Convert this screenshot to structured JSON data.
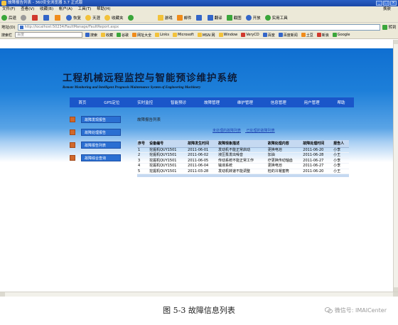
{
  "browser": {
    "title": "故障报告列表 - 360安全浏览器 3.7 正式版",
    "menu": [
      "文件(F)",
      "查看(V)",
      "收藏(B)",
      "帐户(A)",
      "工具(T)",
      "帮助(H)"
    ],
    "menu_right": "换肤",
    "toolbar": [
      "后退",
      "前进",
      "停止",
      "刷新",
      "主页",
      "恢复",
      "天涯",
      "收藏夹",
      "游戏",
      "邮件",
      "翻译",
      "截图",
      "开放",
      "实用工具"
    ],
    "address_label": "地址(D)",
    "address": "http://localhost:50234/FaultManage/FaultReport.aspx",
    "go_label": "转到",
    "favbar_label": "搜索栏",
    "search_placeholder": "百度",
    "favorites": [
      "搜索",
      "收藏",
      "谷歌",
      "网址大全",
      "Links",
      "Microsoft",
      "MSN 网",
      "Window",
      "VeryCD",
      "百度",
      "百度新闻",
      "土豆",
      "新浪",
      "Google"
    ]
  },
  "page": {
    "title": "工程机械远程监控与智能预诊维护系统",
    "subtitle": "Remote Monitoring and Intelligent Prognosis Maintenance System of Engineering Machinery",
    "nav": [
      "首页",
      "GPS定位",
      "实时监控",
      "智能预诊",
      "故障管理",
      "维护管理",
      "信息管理",
      "用户管理",
      "帮助"
    ],
    "sidebar": [
      "故障发现报告",
      "故障处理报告",
      "故障报告列表",
      "故障综合查询"
    ],
    "content_title": "故障报告列表",
    "links": [
      "未处理的故障列表",
      "已处理的故障列表"
    ],
    "table": {
      "headers": [
        "序号",
        "设备编号",
        "故障发生时间",
        "故障现象描述",
        "故障处理内容",
        "故障处理时间",
        "报告人"
      ],
      "rows": [
        [
          "1",
          "挖掘机QUY1501",
          "2011-06-01",
          "发动机不能正常启动",
          "更换电池",
          "2011-06-20",
          "小李"
        ],
        [
          "2",
          "挖掘机QUY1501",
          "2011-06-02",
          "液压泵发出噪音",
          "加油",
          "2011-06-28",
          "小王"
        ],
        [
          "3",
          "挖掘机QUY1501",
          "2011-06-05",
          "传动系统不能正常工作",
          "疗更换传动轴齿",
          "2011-06-27",
          "小李"
        ],
        [
          "4",
          "挖掘机QUY1501",
          "2011-06-04",
          "输液系统",
          "更换电池",
          "2011-06-27",
          "小李"
        ],
        [
          "5",
          "挖掘机QUY1501",
          "2011-03-28",
          "发动机转速不能调整",
          "检的冷凝套筒",
          "2011-06-20",
          "小王"
        ]
      ]
    }
  },
  "figure": {
    "caption": "图 5-3  故障信息列表",
    "watermark": "微信号: IMAICenter"
  }
}
